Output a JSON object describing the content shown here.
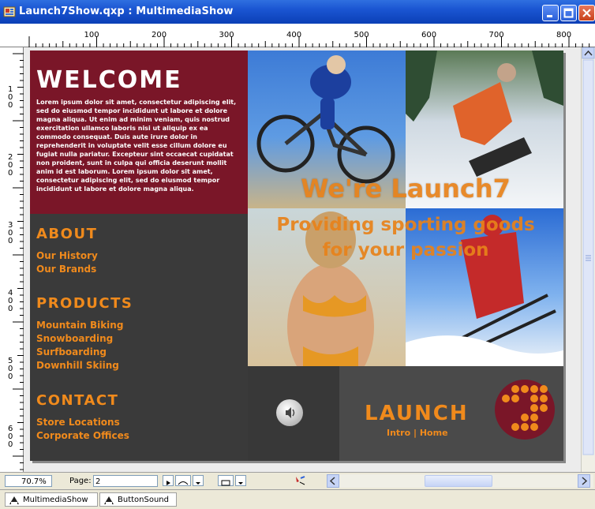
{
  "window": {
    "title": "Launch7Show.qxp : MultimediaShow"
  },
  "ruler": {
    "labels": [
      "100",
      "200",
      "300",
      "400",
      "500",
      "600",
      "700",
      "800"
    ],
    "vlabels": [
      "1",
      "0",
      "0",
      "2",
      "0",
      "0",
      "3",
      "0",
      "0",
      "4",
      "0",
      "0",
      "5",
      "0",
      "0",
      "6",
      "0",
      "0"
    ]
  },
  "page": {
    "welcome": {
      "heading": "WELCOME",
      "body": "Lorem ipsum dolor sit amet, consectetur adipiscing elit, sed do eiusmod tempor incididunt ut labore et dolore magna aliqua. Ut enim ad minim veniam, quis nostrud exercitation ullamco laboris nisi ut aliquip ex ea commodo consequat. Duis aute irure dolor in reprehenderit in voluptate velit esse cillum dolore eu fugiat nulla pariatur. Excepteur sint occaecat cupidatat non proident, sunt in culpa qui officia deserunt mollit anim id est laborum. Lorem ipsum dolor sit amet, consectetur adipiscing elit, sed do eiusmod tempor incididunt ut labore et dolore magna aliqua."
    },
    "about": {
      "heading": "ABOUT",
      "links": [
        "Our History",
        "Our Brands"
      ]
    },
    "products": {
      "heading": "PRODUCTS",
      "links": [
        "Mountain Biking",
        "Snowboarding",
        "Surfboarding",
        "Downhill Skiing"
      ]
    },
    "contact": {
      "heading": "CONTACT",
      "links": [
        "Store Locations",
        "Corporate Offices"
      ]
    },
    "hero": {
      "headline": "We're Launch7",
      "tagline_line1": "Providing sporting goods",
      "tagline_line2": "for your passion"
    },
    "logo": {
      "text": "LAUNCH",
      "nav": "Intro | Home"
    }
  },
  "status": {
    "zoom": "70.7%",
    "page_label": "Page:",
    "page_value": "2"
  },
  "tabs": [
    "MultimediaShow",
    "ButtonSound"
  ],
  "colors": {
    "accent": "#f08a1c",
    "maroon": "#7a1628",
    "page_bg": "#3a3a3a"
  }
}
